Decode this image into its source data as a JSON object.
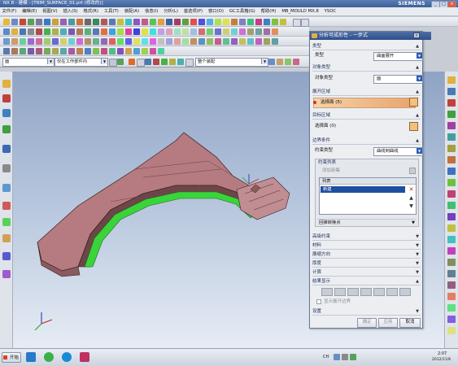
{
  "titlebar": {
    "title": "NX 8 - 建模 - [TRIM_SURFACE_01.prt (修改的)]",
    "brand": "SIEMENS"
  },
  "menu": {
    "items": [
      "文件(F)",
      "编辑(E)",
      "视图(V)",
      "插入(S)",
      "格式(R)",
      "工具(T)",
      "装配(A)",
      "信息(I)",
      "分析(L)",
      "首选项(P)",
      "窗口(O)",
      "GC工具箱(G)",
      "帮助(H)",
      "MB_MOULD MX.8",
      "YSOC"
    ]
  },
  "combos": {
    "filter": "面",
    "scope": "仅在工作部件内",
    "layer": "整个装配"
  },
  "dialog": {
    "title": "分析可成形性 - 一步式",
    "type_section": "类型",
    "type_label": "类型",
    "type_value": "曲面展开",
    "object_section": "对象类型",
    "object_label": "对象类型",
    "object_value": "面",
    "region_section": "展开区域",
    "region_select": "选择面 (5)",
    "target_section": "目标区域",
    "target_select": "选择面 (0)",
    "boundary_section": "边界条件",
    "constraint_label": "约束类型",
    "constraint_value": "曲线到曲线",
    "constraint_list_header": "约束列表",
    "add_new": "添加新集",
    "list_header": "列表",
    "list_item": "新建",
    "transfer_section": "回弹转换点",
    "advanced_section": "高级约束",
    "material_section": "材料",
    "direction_section": "展缩方向",
    "thickness_section": "厚度",
    "calc_section": "计算",
    "result_section": "结果显示",
    "show_flattened": "显示展开边界",
    "settings_section": "设置",
    "ok": "确定",
    "apply": "应用",
    "cancel": "取消"
  },
  "taskbar": {
    "start": "开始",
    "lang": "CH",
    "time": "2:07",
    "date": "2012/11/6"
  }
}
